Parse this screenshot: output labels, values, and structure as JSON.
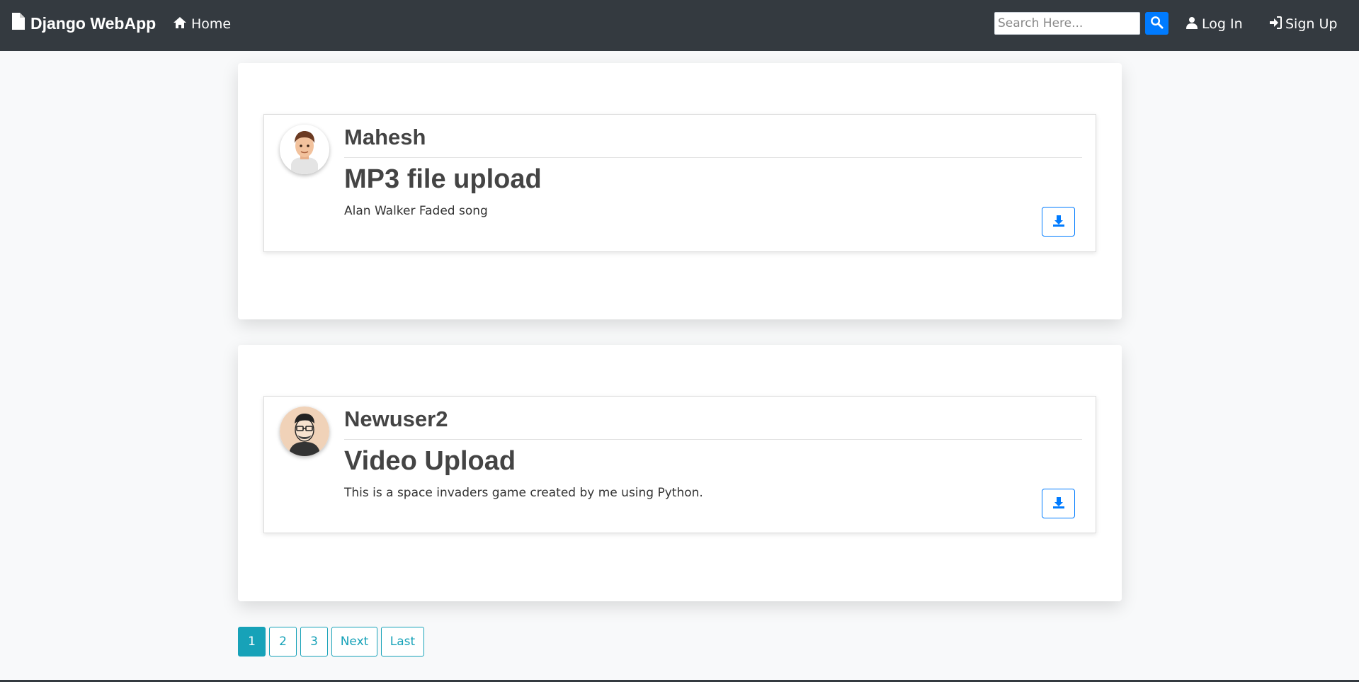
{
  "navbar": {
    "brand": "Django WebApp",
    "home_label": "Home",
    "search_placeholder": "Search Here...",
    "login_label": "Log In",
    "signup_label": "Sign Up"
  },
  "posts": [
    {
      "author": "Mahesh",
      "title": "MP3 file upload",
      "description": "Alan Walker Faded song"
    },
    {
      "author": "Newuser2",
      "title": "Video Upload",
      "description": "This is a space invaders game created by me using Python."
    }
  ],
  "pagination": {
    "pages": [
      "1",
      "2",
      "3"
    ],
    "next_label": "Next",
    "last_label": "Last",
    "active_page": "1"
  },
  "colors": {
    "navbar": "#343a40",
    "primary": "#007bff",
    "pagination": "#17a2b8"
  },
  "icons": [
    "file-icon",
    "home-icon",
    "search-icon",
    "user-icon",
    "sign-in-icon",
    "download-icon"
  ]
}
